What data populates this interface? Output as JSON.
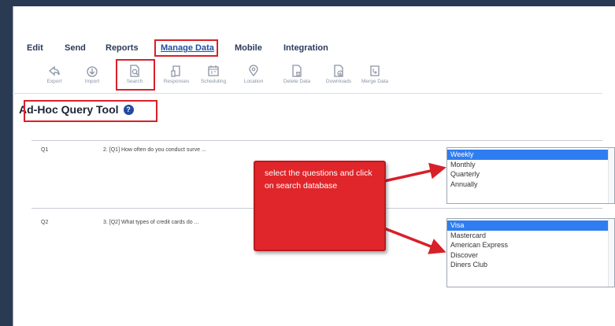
{
  "menu": {
    "edit": "Edit",
    "send": "Send",
    "reports": "Reports",
    "manage_data": "Manage Data",
    "mobile": "Mobile",
    "integration": "Integration"
  },
  "toolbar": {
    "export": "Export",
    "import": "Import",
    "search": "Search",
    "responses": "Responses",
    "scheduling": "Scheduling",
    "location": "Location",
    "delete_data": "Delete Data",
    "downloads": "Downloads",
    "merge_data": "Merge Data"
  },
  "page": {
    "title": "Ad-Hoc Query Tool"
  },
  "questions": [
    {
      "num": "Q1",
      "text": "2. [Q1] How often do you conduct surve ...",
      "options": [
        "Weekly",
        "Monthly",
        "Quarterly",
        "Annually"
      ],
      "selected": "Weekly"
    },
    {
      "num": "Q2",
      "text": "3. [Q2] What types of credit cards do ...",
      "options": [
        "Visa",
        "Mastercard",
        "American Express",
        "Discover",
        "Diners Club"
      ],
      "selected": "Visa"
    }
  ],
  "callout": {
    "text": "select the questions and click on search database"
  },
  "colors": {
    "highlight": "#d8202a",
    "selected_option": "#2f7df0",
    "help_icon": "#1f4c9f",
    "frame_bg": "#2a3a52"
  },
  "icons": [
    "export-icon",
    "import-icon",
    "search-icon",
    "responses-icon",
    "scheduling-icon",
    "location-icon",
    "delete-data-icon",
    "downloads-icon",
    "merge-data-icon",
    "help-icon"
  ]
}
